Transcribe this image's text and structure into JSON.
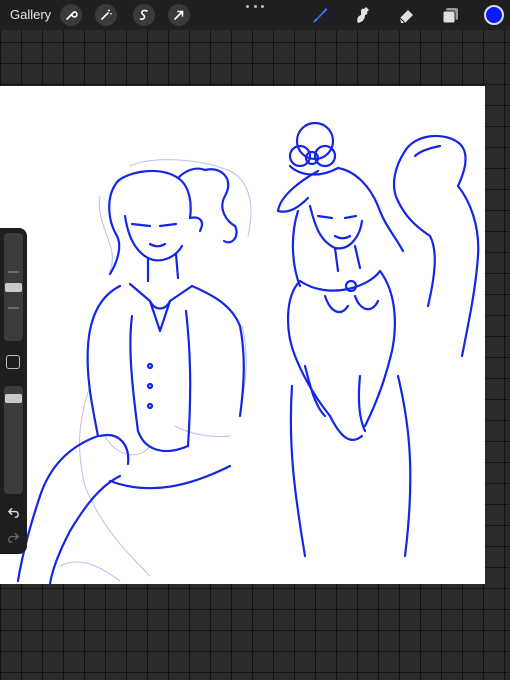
{
  "topbar": {
    "gallery_label": "Gallery",
    "left_tools": [
      {
        "icon": "wrench-icon"
      },
      {
        "icon": "magic-wand-icon"
      },
      {
        "icon": "selection-icon"
      },
      {
        "icon": "transform-arrow-icon"
      }
    ],
    "right_tools": [
      {
        "icon": "brush-icon",
        "active": true
      },
      {
        "icon": "smudge-icon",
        "active": false
      },
      {
        "icon": "eraser-icon",
        "active": false
      },
      {
        "icon": "layers-icon",
        "active": false
      }
    ],
    "current_color": "#0a1cff",
    "accent_color": "#3478f6"
  },
  "canvas": {
    "background": "#ffffff",
    "ink_color": "#1426e6",
    "sketch_color": "#b9bff0"
  },
  "sidebar": {
    "brush_size_level": 0.5,
    "opacity_level": 0.92
  }
}
